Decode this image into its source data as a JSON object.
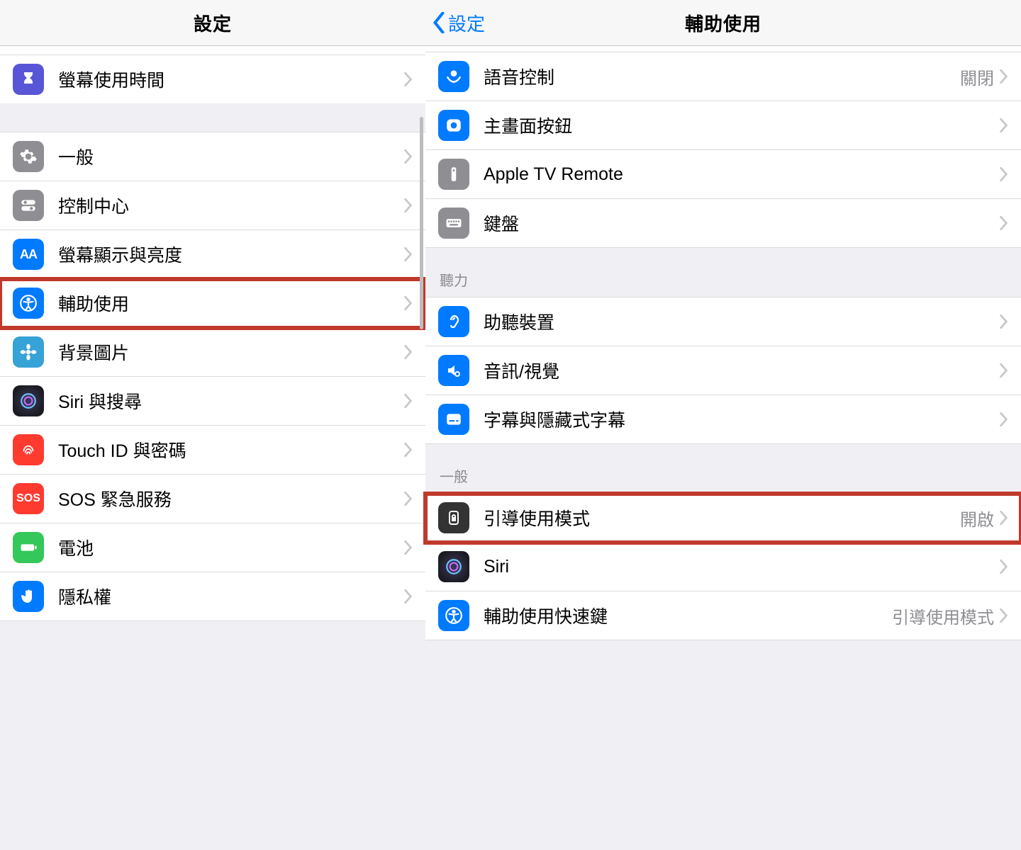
{
  "left": {
    "title": "設定",
    "rows": [
      {
        "label": "螢幕使用時間"
      },
      {
        "label": "一般"
      },
      {
        "label": "控制中心"
      },
      {
        "label": "螢幕顯示與亮度"
      },
      {
        "label": "輔助使用"
      },
      {
        "label": "背景圖片"
      },
      {
        "label": "Siri 與搜尋"
      },
      {
        "label": "Touch ID 與密碼"
      },
      {
        "label": "SOS 緊急服務"
      },
      {
        "label": "電池"
      },
      {
        "label": "隱私權"
      }
    ]
  },
  "right": {
    "back": "設定",
    "title": "輔助使用",
    "group1": [
      {
        "label": "語音控制",
        "value": "關閉"
      },
      {
        "label": "主畫面按鈕"
      },
      {
        "label": "Apple TV Remote"
      },
      {
        "label": "鍵盤"
      }
    ],
    "header_hearing": "聽力",
    "group2": [
      {
        "label": "助聽裝置"
      },
      {
        "label": "音訊/視覺"
      },
      {
        "label": "字幕與隱藏式字幕"
      }
    ],
    "header_general": "一般",
    "group3": [
      {
        "label": "引導使用模式",
        "value": "開啟"
      },
      {
        "label": "Siri"
      },
      {
        "label": "輔助使用快速鍵",
        "value": "引導使用模式"
      }
    ]
  }
}
